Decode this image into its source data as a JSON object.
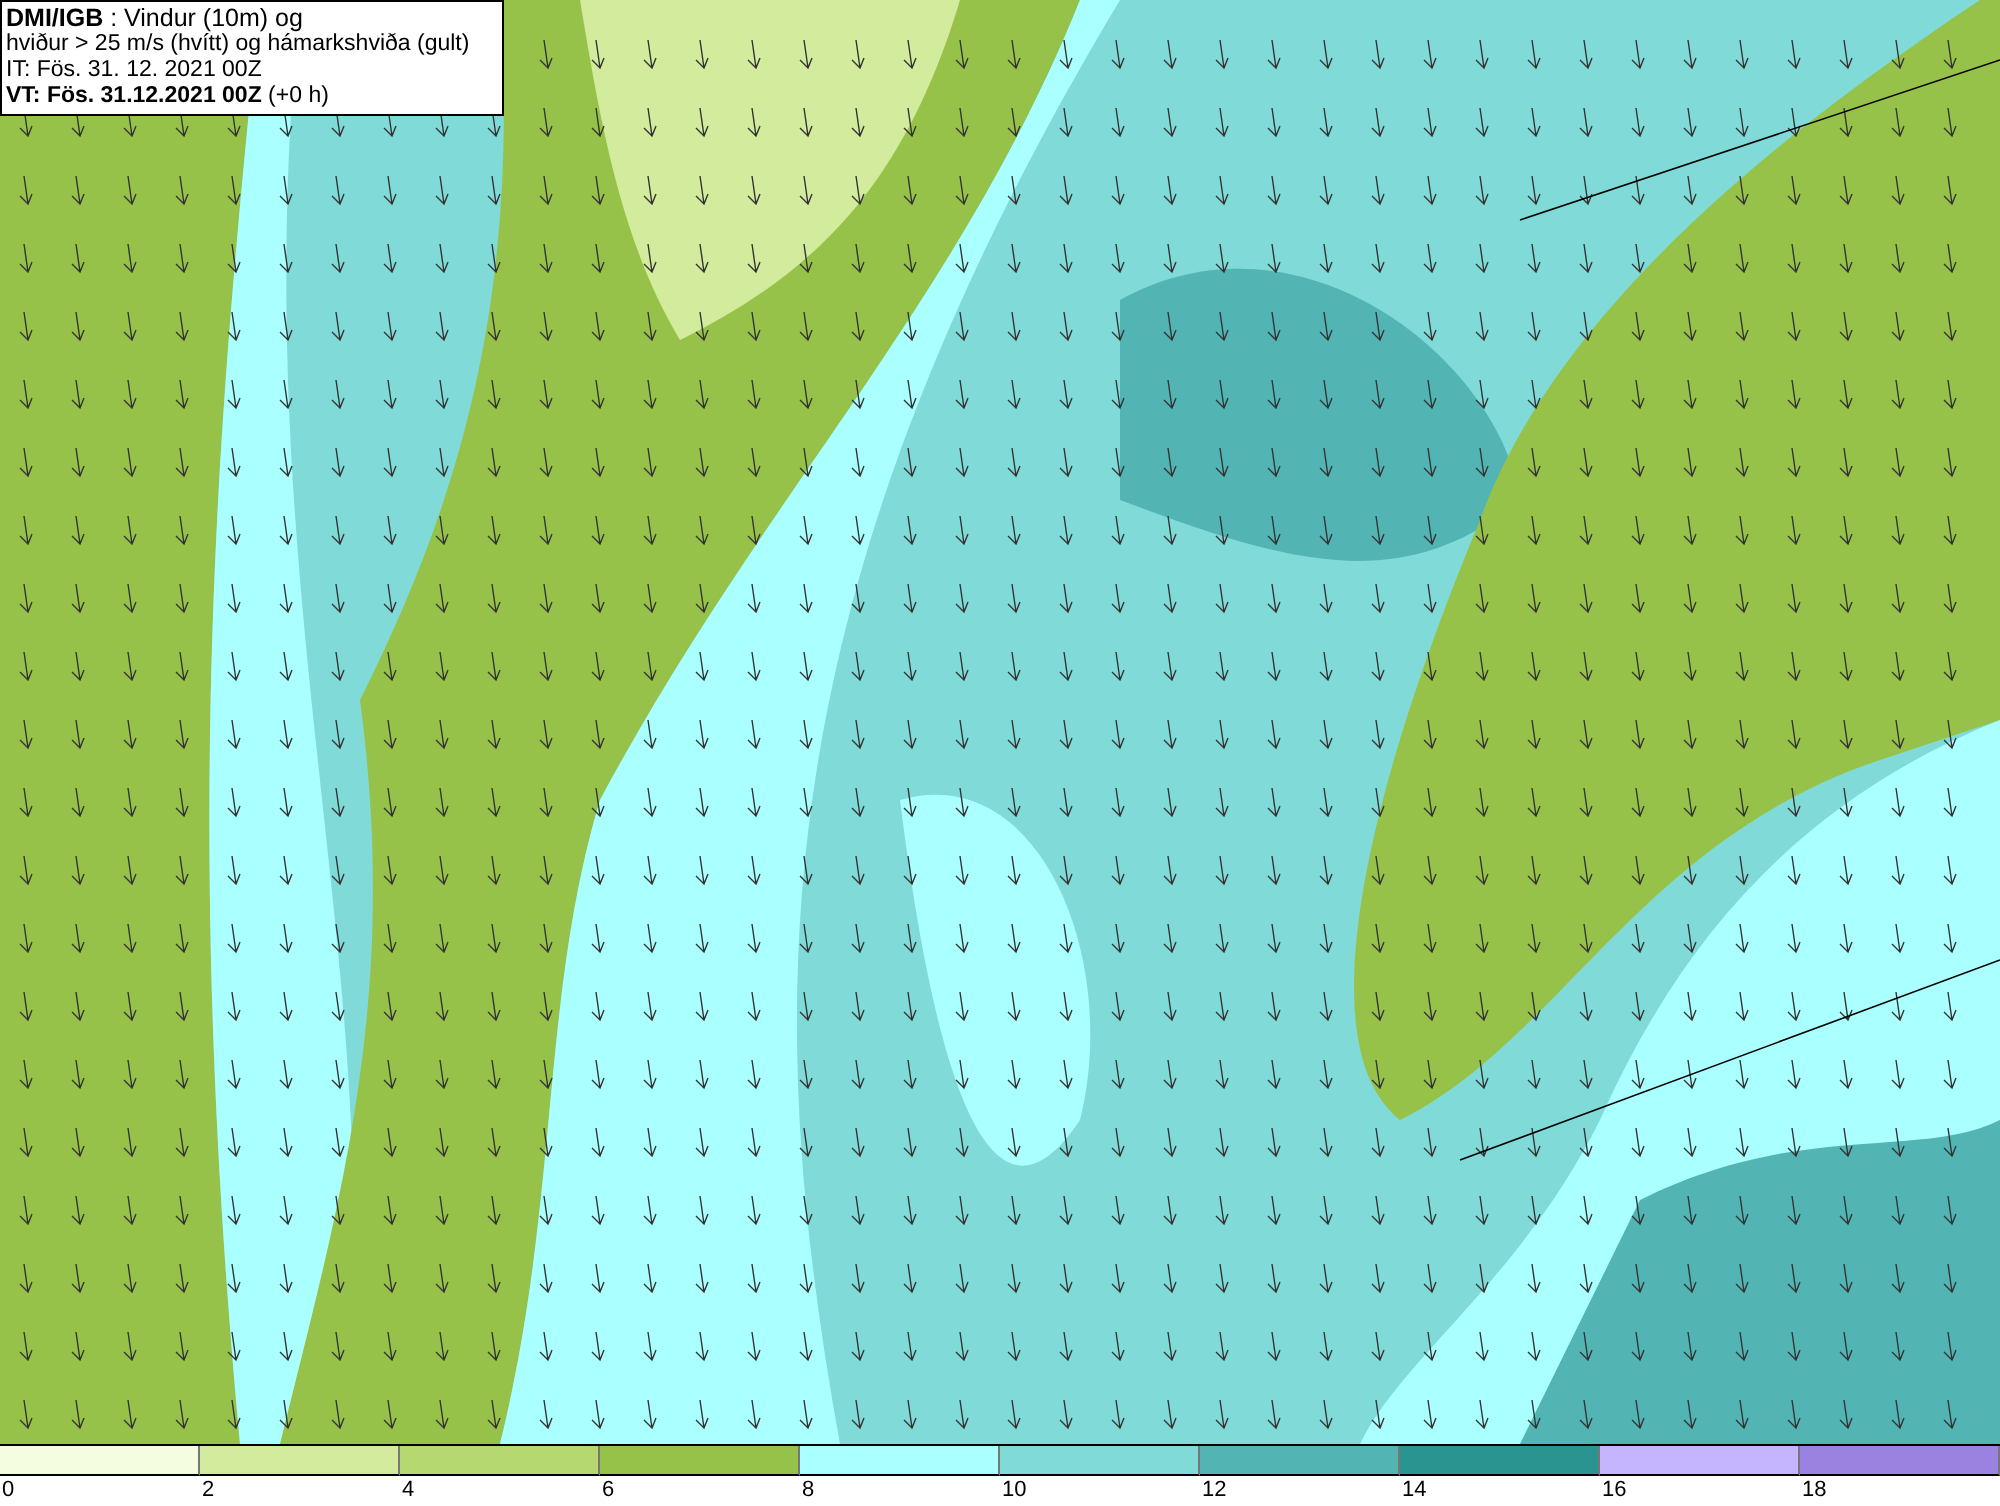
{
  "header": {
    "lines": [
      "**DMI/IGB** : Vindur (10m) og",
      "hviður > 25 m/s (hvítt) og hámarkshviða (gult)",
      "IT: Fös. 31. 12. 2021 00Z",
      "**VT: Fös. 31.12.2021 00Z** (+0 h)"
    ]
  },
  "legend": {
    "segments": [
      {
        "color": "#f5fde0",
        "label": "0"
      },
      {
        "color": "#d2eb9c",
        "label": "2"
      },
      {
        "color": "#b5d870",
        "label": "4"
      },
      {
        "color": "#97c24a",
        "label": "6"
      },
      {
        "color": "#aaffff",
        "label": "8"
      },
      {
        "color": "#80dad8",
        "label": "10"
      },
      {
        "color": "#52b5b3",
        "label": "12"
      },
      {
        "color": "#2a9590",
        "label": "14"
      },
      {
        "color": "#c5b4ff",
        "label": "16"
      },
      {
        "color": "#9a82e0",
        "label": "18"
      }
    ]
  }
}
